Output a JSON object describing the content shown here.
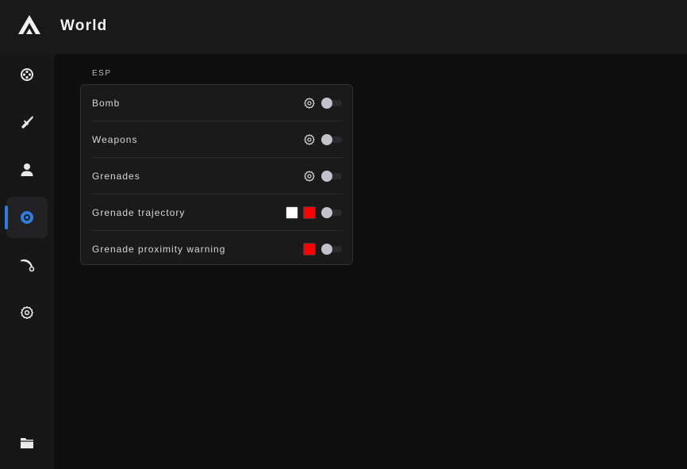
{
  "header": {
    "title": "World",
    "logo_icon": "triangle-logo-icon"
  },
  "sidebar": {
    "accent_color": "#2f7de1",
    "items": [
      {
        "icon": "crosshair-icon",
        "active": false
      },
      {
        "icon": "knife-icon",
        "active": false
      },
      {
        "icon": "person-icon",
        "active": false
      },
      {
        "icon": "eye-icon",
        "active": true
      },
      {
        "icon": "karambit-icon",
        "active": false
      },
      {
        "icon": "gear-icon",
        "active": false
      },
      {
        "icon": "folder-icon",
        "active": false
      }
    ]
  },
  "esp": {
    "section_label": "ESP",
    "rows": [
      {
        "label": "Bomb",
        "has_settings": true,
        "colors": [],
        "enabled": false
      },
      {
        "label": "Weapons",
        "has_settings": true,
        "colors": [],
        "enabled": false
      },
      {
        "label": "Grenades",
        "has_settings": true,
        "colors": [],
        "enabled": false
      },
      {
        "label": "Grenade trajectory",
        "has_settings": false,
        "colors": [
          "#ffffff",
          "#ff0000"
        ],
        "enabled": false
      },
      {
        "label": "Grenade proximity warning",
        "has_settings": false,
        "colors": [
          "#ff0000"
        ],
        "enabled": false
      }
    ]
  }
}
